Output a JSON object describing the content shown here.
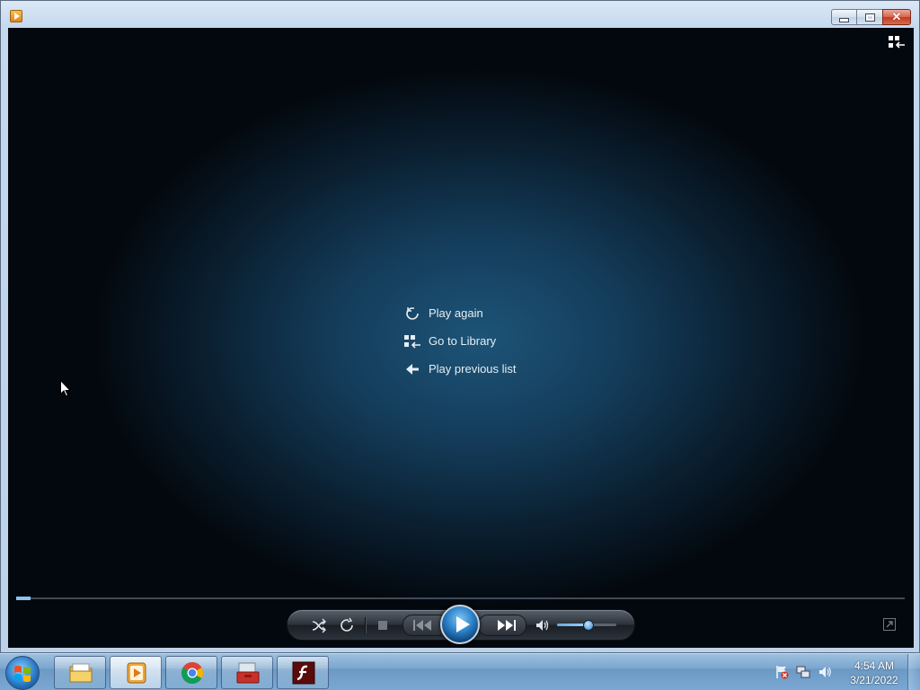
{
  "window": {
    "title": "",
    "buttons": {
      "minimize_icon": "minimize-icon",
      "maximize_icon": "restore-icon",
      "close_icon": "close-icon"
    }
  },
  "overlay_menu": {
    "items": [
      {
        "label": "Play again",
        "icon": "replay-icon"
      },
      {
        "label": "Go to Library",
        "icon": "library-icon"
      },
      {
        "label": "Play previous list",
        "icon": "back-arrow-icon"
      }
    ]
  },
  "playback": {
    "progress_fraction": 0.016,
    "volume_fraction": 0.52,
    "controls": [
      "shuffle-icon",
      "repeat-icon",
      "stop-icon",
      "previous-icon",
      "play-icon",
      "next-icon",
      "mute-icon"
    ]
  },
  "taskbar": {
    "apps": [
      "windows-explorer",
      "windows-media-player",
      "google-chrome",
      "toolbox-app",
      "adobe-flash"
    ],
    "clock": {
      "time": "4:54 AM",
      "date": "3/21/2022"
    }
  },
  "colors": {
    "accent": "#2a7fc6",
    "video_bg": "#143c5a",
    "menu_text": "#e6eef4"
  }
}
